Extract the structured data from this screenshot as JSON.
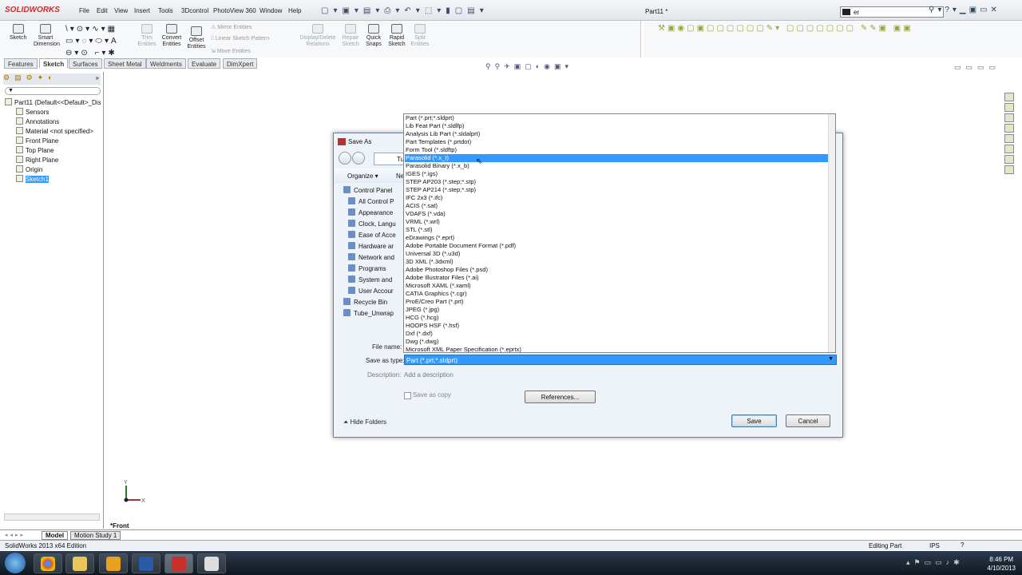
{
  "app": {
    "logo": "SOLIDWORKS",
    "doc_title": "Part11 *",
    "search_value": "er"
  },
  "menu": [
    "File",
    "Edit",
    "View",
    "Insert",
    "Tools",
    "3Dcontrol",
    "PhotoView 360",
    "Window",
    "Help"
  ],
  "ribbon": {
    "sketch": "Sketch",
    "smart_dimension": "Smart Dimension",
    "trim": "Trim Entities",
    "convert": "Convert Entities",
    "offset": "Offset Entities",
    "mirror": "Mirror Entities",
    "linear_pattern": "Linear Sketch Pattern",
    "move": "Move Entities",
    "display_delete": "Display/Delete Relations",
    "repair": "Repair Sketch",
    "quick_snaps": "Quick Snaps",
    "rapid_sketch": "Rapid Sketch",
    "split": "Split Entities"
  },
  "tabs": [
    "Features",
    "Sketch",
    "Surfaces",
    "Sheet Metal",
    "Weldments",
    "Evaluate",
    "DimXpert"
  ],
  "tree": {
    "root": "Part11  (Default<<Default>_Dis",
    "items": [
      "Sensors",
      "Annotations",
      "Material <not specified>",
      "Front Plane",
      "Top Plane",
      "Right Plane",
      "Origin",
      "Sketch1"
    ]
  },
  "dialog": {
    "title": "Save As",
    "address": "Tu",
    "organize": "Organize ▾",
    "new_folder": "Ne",
    "folders": [
      "Control Panel",
      "All Control P",
      "Appearance",
      "Clock, Langu",
      "Ease of Acce",
      "Hardware ar",
      "Network and",
      "Programs",
      "System and",
      "User Accour",
      "Recycle Bin",
      "Tube_Unwrap"
    ],
    "file_name_label": "File name:",
    "save_as_type_label": "Save as type:",
    "save_as_type_value": "Part (*.prt;*.sldprt)",
    "description_label": "Description:",
    "description_value": "Add a description",
    "save_as_copy": "Save as copy",
    "references": "References...",
    "hide_folders": "Hide Folders",
    "save": "Save",
    "cancel": "Cancel"
  },
  "dropdown": {
    "highlighted_index": 5,
    "options": [
      "Part (*.prt;*.sldprt)",
      "Lib Feat Part (*.sldlfp)",
      "Analysis Lib Part (*.sldalprt)",
      "Part Templates (*.prtdot)",
      "Form Tool (*.sldftp)",
      "Parasolid (*.x_t)",
      "Parasolid Binary (*.x_b)",
      "IGES (*.igs)",
      "STEP AP203 (*.step;*.stp)",
      "STEP AP214 (*.step;*.stp)",
      "IFC 2x3 (*.ifc)",
      "ACIS (*.sat)",
      "VDAFS (*.vda)",
      "VRML (*.wrl)",
      "STL (*.stl)",
      "eDrawings (*.eprt)",
      "Adobe Portable Document Format (*.pdf)",
      "Universal 3D (*.u3d)",
      "3D XML (*.3dxml)",
      "Adobe Photoshop Files (*.psd)",
      "Adobe Illustrator Files (*.ai)",
      "Microsoft XAML (*.xaml)",
      "CATIA Graphics (*.cgr)",
      "ProE/Creo Part (*.prt)",
      "JPEG (*.jpg)",
      "HCG (*.hcg)",
      "HOOPS HSF (*.hsf)",
      "Dxf (*.dxf)",
      "Dwg (*.dwg)",
      "Microsoft XML Paper Specification (*.eprtx)"
    ]
  },
  "viewport": {
    "view_label": "*Front",
    "axis_x": "X",
    "axis_y": "Y"
  },
  "bottom_tabs": [
    "Model",
    "Motion Study 1"
  ],
  "status": {
    "edition": "SolidWorks 2013 x64 Edition",
    "mode": "Editing Part",
    "units": "IPS"
  },
  "taskbar": {
    "time": "8:46 PM",
    "date": "4/10/2013"
  }
}
